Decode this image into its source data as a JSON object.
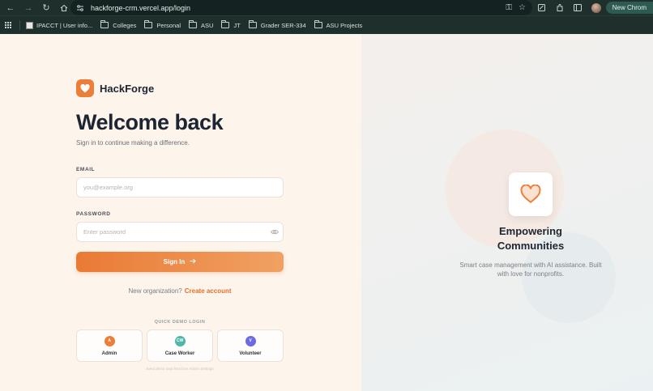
{
  "browser": {
    "url": "hackforge-crm.vercel.app/login",
    "new_chrome_label": "New Chrom"
  },
  "bookmarks": [
    {
      "label": "IPACCT | User info...",
      "type": "site"
    },
    {
      "label": "Colleges",
      "type": "folder"
    },
    {
      "label": "Personal",
      "type": "folder"
    },
    {
      "label": "ASU",
      "type": "folder"
    },
    {
      "label": "JT",
      "type": "folder"
    },
    {
      "label": "Grader SER-334",
      "type": "folder"
    },
    {
      "label": "ASU Projects",
      "type": "folder"
    }
  ],
  "brand": {
    "name": "HackForge",
    "accent": "#ec7e39"
  },
  "login": {
    "title": "Welcome back",
    "subtitle": "Sign in to continue making a difference.",
    "email_label": "EMAIL",
    "email_placeholder": "you@example.org",
    "email_value": "",
    "password_label": "PASSWORD",
    "password_placeholder": "Enter password",
    "password_value": "",
    "signin_label": "Sign In",
    "new_org_text": "New organization?",
    "create_account_label": "Create account"
  },
  "demo": {
    "label": "QUICK DEMO LOGIN",
    "options": [
      {
        "initials": "A",
        "name": "Admin",
        "color": "#ec7e39"
      },
      {
        "initials": "CW",
        "name": "Case Worker",
        "color": "#4fb7a6"
      },
      {
        "initials": "V",
        "name": "Volunteer",
        "color": "#6b6ae0"
      }
    ],
    "hint": "Seed demo data first from Admin Settings"
  },
  "hero": {
    "title_line1": "Empowering",
    "title_line2": "Communities",
    "description": "Smart case management with AI assistance. Built with love for nonprofits."
  }
}
